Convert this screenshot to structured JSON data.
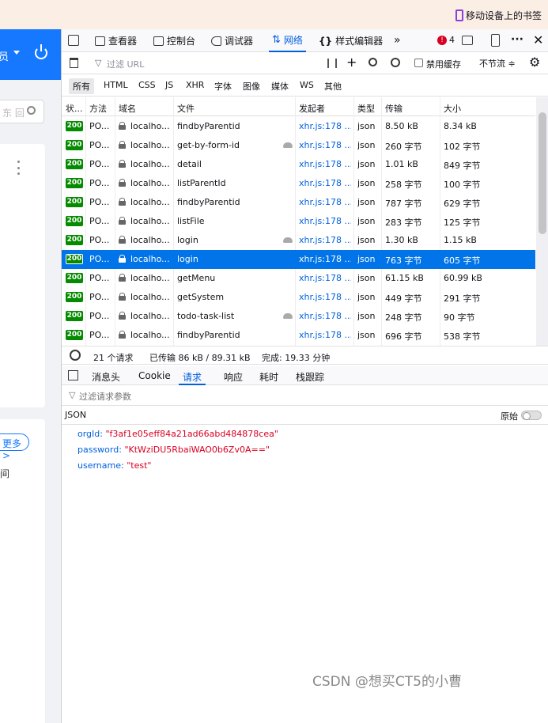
{
  "bookmark": {
    "label": "移动设备上的书签"
  },
  "app": {
    "user": "员",
    "search_placeholder": "东 回",
    "more_label": "更多 >",
    "cut_text": "间"
  },
  "toolbar": {
    "tabs": [
      {
        "label": "查看器",
        "icon": "inspector-icon"
      },
      {
        "label": "控制台",
        "icon": "console-icon"
      },
      {
        "label": "调试器",
        "icon": "debugger-icon"
      },
      {
        "label": "网络",
        "icon": "network-icon",
        "selected": true
      },
      {
        "label": "样式编辑器",
        "icon": "style-editor-icon"
      }
    ],
    "error_count": "4"
  },
  "filter": {
    "placeholder": "过滤 URL",
    "disable_cache": "禁用缓存",
    "throttle": "不节流 ≑"
  },
  "types": [
    "所有",
    "HTML",
    "CSS",
    "JS",
    "XHR",
    "字体",
    "图像",
    "媒体",
    "WS",
    "其他"
  ],
  "columns": [
    "状...",
    "方法",
    "域名",
    "文件",
    "发起者",
    "类型",
    "传输",
    "大小"
  ],
  "rows": [
    {
      "status": "200",
      "method": "PO...",
      "domain": "localho...",
      "file": "findbyParentid",
      "slow": false,
      "initiator": "xhr.js:178 ...",
      "type": "json",
      "transferred": "8.50 kB",
      "size": "8.34 kB"
    },
    {
      "status": "200",
      "method": "PO...",
      "domain": "localho...",
      "file": "get-by-form-id",
      "slow": true,
      "initiator": "xhr.js:178 ...",
      "type": "json",
      "transferred": "260 字节",
      "size": "102 字节"
    },
    {
      "status": "200",
      "method": "PO...",
      "domain": "localho...",
      "file": "detail",
      "slow": false,
      "initiator": "xhr.js:178 ...",
      "type": "json",
      "transferred": "1.01 kB",
      "size": "849 字节"
    },
    {
      "status": "200",
      "method": "PO...",
      "domain": "localho...",
      "file": "listParentId",
      "slow": false,
      "initiator": "xhr.js:178 ...",
      "type": "json",
      "transferred": "258 字节",
      "size": "100 字节"
    },
    {
      "status": "200",
      "method": "PO...",
      "domain": "localho...",
      "file": "findbyParentid",
      "slow": false,
      "initiator": "xhr.js:178 ...",
      "type": "json",
      "transferred": "787 字节",
      "size": "629 字节"
    },
    {
      "status": "200",
      "method": "PO...",
      "domain": "localho...",
      "file": "listFile",
      "slow": false,
      "initiator": "xhr.js:178 ...",
      "type": "json",
      "transferred": "283 字节",
      "size": "125 字节"
    },
    {
      "status": "200",
      "method": "PO...",
      "domain": "localho...",
      "file": "login",
      "slow": true,
      "initiator": "xhr.js:178 ...",
      "type": "json",
      "transferred": "1.30 kB",
      "size": "1.15 kB"
    },
    {
      "status": "200",
      "method": "PO...",
      "domain": "localho...",
      "file": "login",
      "slow": false,
      "initiator": "xhr.js:178 ...",
      "type": "json",
      "transferred": "763 字节",
      "size": "605 字节",
      "selected": true
    },
    {
      "status": "200",
      "method": "PO...",
      "domain": "localho...",
      "file": "getMenu",
      "slow": false,
      "initiator": "xhr.js:178 ...",
      "type": "json",
      "transferred": "61.15 kB",
      "size": "60.99 kB"
    },
    {
      "status": "200",
      "method": "PO...",
      "domain": "localho...",
      "file": "getSystem",
      "slow": false,
      "initiator": "xhr.js:178 ...",
      "type": "json",
      "transferred": "449 字节",
      "size": "291 字节"
    },
    {
      "status": "200",
      "method": "PO...",
      "domain": "localho...",
      "file": "todo-task-list",
      "slow": true,
      "initiator": "xhr.js:178 ...",
      "type": "json",
      "transferred": "248 字节",
      "size": "90 字节"
    },
    {
      "status": "200",
      "method": "PO...",
      "domain": "localho...",
      "file": "findbyParentid",
      "slow": false,
      "initiator": "xhr.js:178 ...",
      "type": "json",
      "transferred": "696 字节",
      "size": "538 字节"
    }
  ],
  "summary": {
    "requests": "21 个请求",
    "transferred": "已传输 86 kB / 89.31 kB",
    "finish": "完成: 19.33 分钟"
  },
  "detail_tabs": [
    "消息头",
    "Cookie",
    "请求",
    "响应",
    "耗时",
    "栈跟踪"
  ],
  "params": {
    "filter_placeholder": "过滤请求参数",
    "json_label": "JSON",
    "raw_label": "原始",
    "entries": [
      {
        "key": "orgId:",
        "value": "\"f3af1e05eff84a21ad66abd484878cea\""
      },
      {
        "key": "password:",
        "value": "\"KtWziDU5RbaiWAO0b6Zv0A==\""
      },
      {
        "key": "username:",
        "value": "\"test\""
      }
    ]
  },
  "watermark": "CSDN @想买CT5的小曹",
  "colors": {
    "accent": "#0060df",
    "selected_row": "#0074e8",
    "status_ok": "#058b00",
    "app_blue": "#1677ff"
  }
}
